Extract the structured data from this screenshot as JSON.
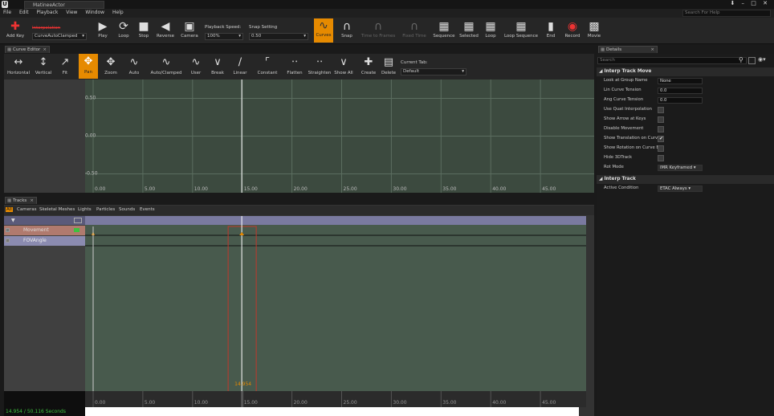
{
  "window": {
    "tab_title": "MatineeActor",
    "controls": "⬇ – □ ✕"
  },
  "menu": [
    "File",
    "Edit",
    "Playback",
    "View",
    "Window",
    "Help"
  ],
  "search_help_placeholder": "Search For Help",
  "toolbar": {
    "add_key": "Add Key",
    "interpolation_label": "Interpolation",
    "interpolation_value": "CurveAutoClamped",
    "play": "Play",
    "loop": "Loop",
    "stop": "Stop",
    "reverse": "Reverse",
    "camera": "Camera",
    "playback_speed_label": "Playback Speed:",
    "playback_speed_value": "100%",
    "snap_setting_label": "Snap Setting",
    "snap_setting_value": "0.50",
    "curves": "Curves",
    "snap": "Snap",
    "time_to_frames": "Time to Frames",
    "fixed_time": "Fixed Time",
    "sequence": "Sequence",
    "selected": "Selected",
    "loop2": "Loop",
    "loop_sequence": "Loop Sequence",
    "end": "End",
    "record": "Record",
    "movie": "Movie"
  },
  "curve_editor": {
    "tab": "Curve Editor",
    "tools": [
      "Horizontal",
      "Vertical",
      "Fit",
      "Pan",
      "Zoom",
      "Auto",
      "Auto/Clamped",
      "User",
      "Break",
      "Linear",
      "Constant",
      "Flatten",
      "Straighten",
      "Show All",
      "Create",
      "Delete"
    ],
    "current_tab_label": "Current Tab:",
    "current_tab_value": "Default",
    "y_labels": [
      "0.50",
      "0.00",
      "-0.50"
    ],
    "x_labels": [
      "0.00",
      "5.00",
      "10.00",
      "15.00",
      "20.00",
      "25.00",
      "30.00",
      "35.00",
      "40.00",
      "45.00"
    ]
  },
  "tracks": {
    "tab": "Tracks",
    "filters": [
      "All",
      "Cameras",
      "Skeletal Meshes",
      "Lights",
      "Particles",
      "Sounds",
      "Events"
    ],
    "group_name": "",
    "track_names": [
      "Movement",
      "FOVAngle"
    ],
    "cursor_time": "14.954",
    "x_labels": [
      "0.00",
      "5.00",
      "10.00",
      "15.00",
      "20.00",
      "25.00",
      "30.00",
      "35.00",
      "40.00",
      "45.00"
    ],
    "status": "14.954 / 50.116 Seconds"
  },
  "details": {
    "tab": "Details",
    "search_placeholder": "Search",
    "section1": "Interp Track Move",
    "props": [
      {
        "label": "Look at Group Name",
        "value": "None",
        "kind": "text"
      },
      {
        "label": "Lin Curve Tension",
        "value": "0.0",
        "kind": "num"
      },
      {
        "label": "Ang Curve Tension",
        "value": "0.0",
        "kind": "num"
      },
      {
        "label": "Use Quat Interpolation",
        "kind": "check",
        "checked": false
      },
      {
        "label": "Show Arrow at Keys",
        "kind": "check",
        "checked": false
      },
      {
        "label": "Disable Movement",
        "kind": "check",
        "checked": false
      },
      {
        "label": "Show Translation on Curv",
        "kind": "check",
        "checked": true
      },
      {
        "label": "Show Rotation on Curve E",
        "kind": "check",
        "checked": false
      },
      {
        "label": "Hide 3DTrack",
        "kind": "check",
        "checked": false
      },
      {
        "label": "Rot Mode",
        "value": "IMR Keyframed",
        "kind": "select"
      }
    ],
    "section2": "Interp Track",
    "props2": [
      {
        "label": "Active Condition",
        "value": "ETAC Always",
        "kind": "select"
      }
    ]
  },
  "chart_data": {
    "type": "line",
    "x_range": [
      0,
      50.116
    ],
    "ylim": [
      -0.75,
      0.75
    ],
    "y_ticks": [
      0.5,
      0.0,
      -0.5
    ],
    "x_ticks": [
      0,
      5,
      10,
      15,
      20,
      25,
      30,
      35,
      40,
      45
    ],
    "cursor": 14.954,
    "grid": true,
    "series": []
  },
  "colors": {
    "accent": "#e68a00",
    "curve_bg": "#3c4a3f",
    "track_bg": "#485a4d",
    "cursor": "#ffffff",
    "selection": "#c0392b",
    "status_green": "#3ec13e"
  }
}
